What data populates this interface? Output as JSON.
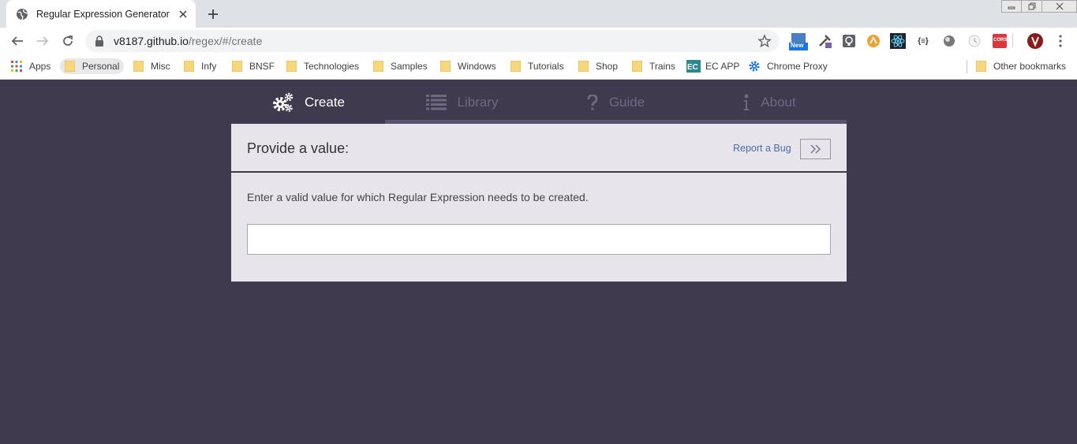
{
  "browser": {
    "tab_title": "Regular Expression Generator",
    "url_host": "v8187.github.io",
    "url_path": "/regex/#/create",
    "bookmarks": [
      {
        "label": "Apps",
        "icon": "apps-grid-icon"
      },
      {
        "label": "Personal",
        "icon": "folder-icon"
      },
      {
        "label": "Misc",
        "icon": "folder-icon"
      },
      {
        "label": "Infy",
        "icon": "folder-icon"
      },
      {
        "label": "BNSF",
        "icon": "folder-icon"
      },
      {
        "label": "Technologies",
        "icon": "folder-icon"
      },
      {
        "label": "Samples",
        "icon": "folder-icon"
      },
      {
        "label": "Windows",
        "icon": "folder-icon"
      },
      {
        "label": "Tutorials",
        "icon": "folder-icon"
      },
      {
        "label": "Shop",
        "icon": "folder-icon"
      },
      {
        "label": "Trains",
        "icon": "folder-icon"
      },
      {
        "label": "EC APP",
        "icon": "ec-app-icon"
      },
      {
        "label": "Chrome Proxy",
        "icon": "gear-icon"
      }
    ],
    "other_bookmarks": "Other bookmarks",
    "extension_badges": {
      "new": "New",
      "cors": "CORS",
      "json": "{≡}"
    }
  },
  "app": {
    "tabs": [
      {
        "label": "Create",
        "icon": "gears-icon"
      },
      {
        "label": "Library",
        "icon": "list-icon"
      },
      {
        "label": "Guide",
        "icon": "question-icon"
      },
      {
        "label": "About",
        "icon": "info-icon"
      }
    ],
    "panel": {
      "title": "Provide a value:",
      "report_bug": "Report a Bug",
      "instruction": "Enter a valid value for which Regular Expression needs to be created.",
      "input_value": "",
      "input_placeholder": ""
    }
  },
  "colors": {
    "page_bg": "#403a4e",
    "panel_bg": "#e7e4ec",
    "tab_inactive": "#6f6884",
    "link": "#4a6fa5"
  }
}
